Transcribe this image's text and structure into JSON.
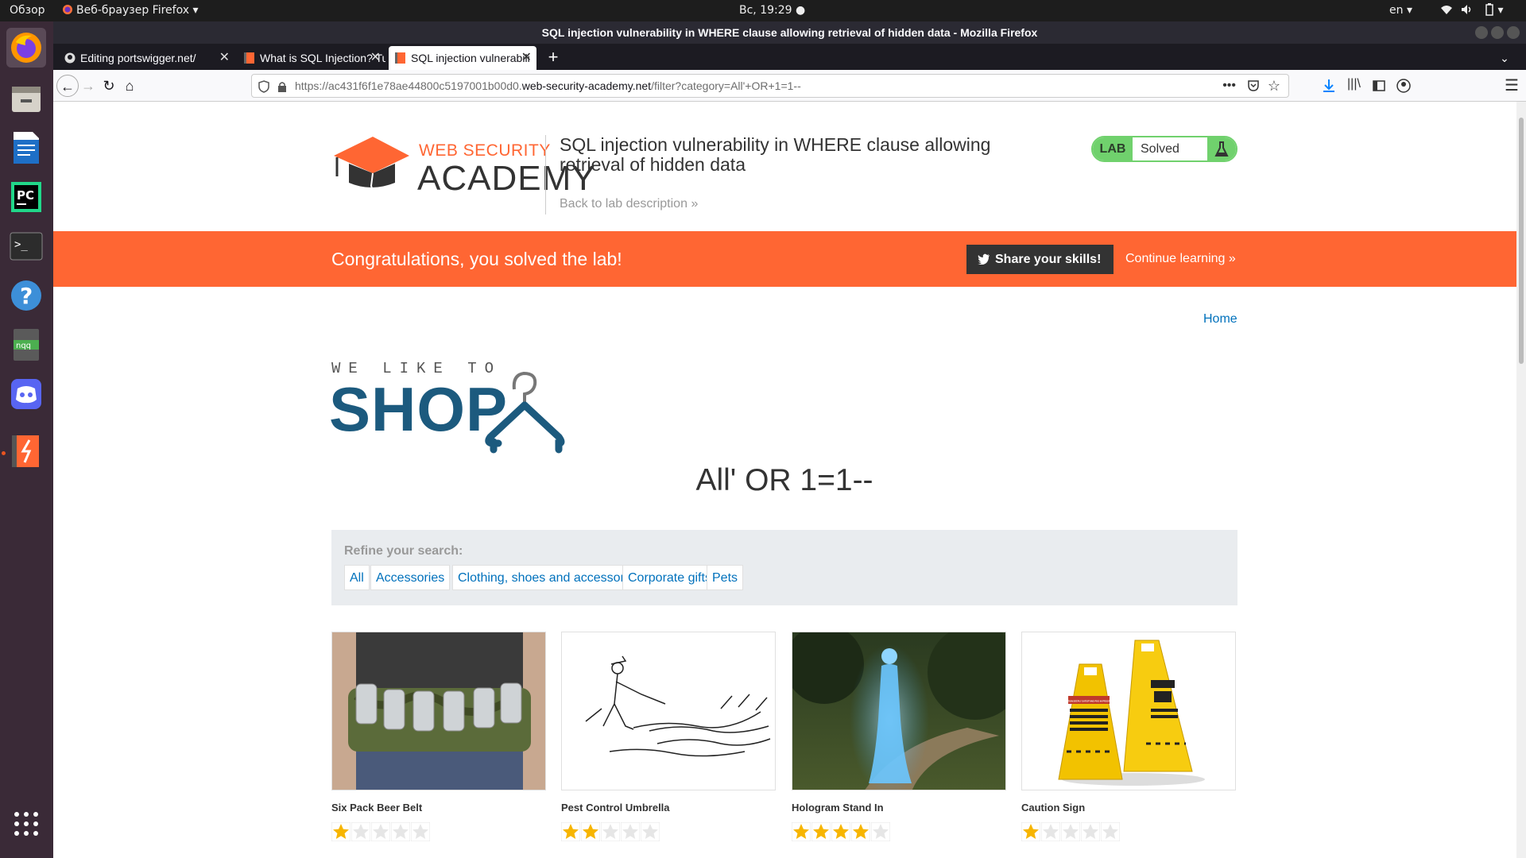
{
  "os_panel": {
    "activities": "Обзор",
    "app_menu": "Веб-браузер Firefox",
    "clock": "Вс, 19:29",
    "lang": "en"
  },
  "browser": {
    "window_title": "SQL injection vulnerability in WHERE clause allowing retrieval of hidden data - Mozilla Firefox",
    "tabs": [
      {
        "label": "Editing portswigger.net/"
      },
      {
        "label": "What is SQL Injection? Tu"
      },
      {
        "label": "SQL injection vulnerabili"
      }
    ],
    "url_prefix": "https://ac431f6f1e78ae44800c5197001b00d0.",
    "url_domain": "web-security-academy.net",
    "url_path": "/filter?category=All'+OR+1=1--"
  },
  "academy": {
    "logo_line1": "WEB SECURITY",
    "logo_line2": "ACADEMY",
    "lab_title": "SQL injection vulnerability in WHERE clause allowing retrieval of hidden data",
    "back_link": "Back to lab description",
    "lab_badge_label": "LAB",
    "lab_status": "Solved"
  },
  "banner": {
    "message": "Congratulations, you solved the lab!",
    "share_button": "Share your skills!",
    "continue_link": "Continue learning"
  },
  "shop": {
    "home_link": "Home",
    "logo_small": "WE LIKE TO",
    "logo_big": "SHOP",
    "heading": "All' OR 1=1--",
    "refine_label": "Refine your search:",
    "categories": [
      "All",
      "Accessories",
      "Clothing, shoes and accessories",
      "Corporate gifts",
      "Pets"
    ],
    "products": [
      {
        "name": "Six Pack Beer Belt",
        "rating": 1
      },
      {
        "name": "Pest Control Umbrella",
        "rating": 2
      },
      {
        "name": "Hologram Stand In",
        "rating": 4
      },
      {
        "name": "Caution Sign",
        "rating": 1
      }
    ],
    "caution_sign_text": "CAUTION DEEPLY SATISFYING POO IN PROGRESS"
  },
  "colors": {
    "accent_orange": "#ff6633",
    "lab_green": "#70d16d",
    "link_blue": "#0071bc",
    "shop_blue": "#1c5a7e"
  }
}
